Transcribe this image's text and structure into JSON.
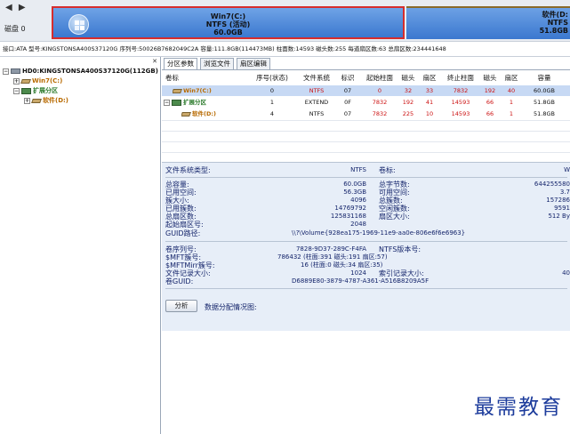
{
  "nav": {
    "arrows": "◀ ▶"
  },
  "disk_bar": {
    "disk_label": "磁盘 0",
    "partitions": [
      {
        "name": "Win7(C:)",
        "fs": "NTFS (活动)",
        "size": "60.0GB"
      },
      {
        "name": "软件(D:",
        "fs": "NTFS",
        "size": "51.8GB"
      }
    ]
  },
  "info_bar": {
    "text": "接口:ATA  型号:KINGSTONSA400S37120G  序列号:50026B7682049C2A  容量:111.8GB(114473MB)  柱面数:14593  磁头数:255  每道扇区数:63  总扇区数:234441648"
  },
  "tree": {
    "close": "✕",
    "items": [
      {
        "box": "−",
        "label": "HD0:KINGSTONSA400S37120G(112GB)"
      },
      {
        "box": "+",
        "label": "Win7(C:)"
      },
      {
        "box": "−",
        "label": "扩展分区"
      },
      {
        "box": "+",
        "label": "软件(D:)"
      }
    ]
  },
  "tabs": [
    "分区参数",
    "浏览文件",
    "扇区编辑"
  ],
  "table": {
    "headers": [
      "卷标",
      "序号(状态)",
      "文件系统",
      "标识",
      "起始柱面",
      "磁头",
      "扇区",
      "终止柱面",
      "磁头",
      "扇区",
      "容量"
    ],
    "rows": [
      [
        "Win7(C:)",
        "0",
        "NTFS",
        "07",
        "0",
        "32",
        "33",
        "7832",
        "192",
        "40",
        "60.0GB"
      ],
      [
        "扩展分区",
        "1",
        "EXTEND",
        "0F",
        "7832",
        "192",
        "41",
        "14593",
        "66",
        "1",
        "51.8GB"
      ],
      [
        "软件(D:)",
        "4",
        "NTFS",
        "07",
        "7832",
        "225",
        "10",
        "14593",
        "66",
        "1",
        "51.8GB"
      ]
    ]
  },
  "details": {
    "fs_type_label": "文件系统类型:",
    "fs_type_value": "NTFS",
    "volume_label": "卷标:",
    "volume_value": "W",
    "left_labels": [
      "总容量:",
      "已用空间:",
      "簇大小:",
      "已用簇数:",
      "总扇区数:",
      "起始扇区号:"
    ],
    "left_values": [
      "60.0GB",
      "56.3GB",
      "4096",
      "14769792",
      "125831168",
      "2048"
    ],
    "right_labels": [
      "总字节数:",
      "可用空间:",
      "总簇数:",
      "空闲簇数:",
      "扇区大小:"
    ],
    "right_values": [
      "644255580",
      "3.7",
      "157286",
      "9591",
      "512 By"
    ],
    "guid_path_label": "GUID路径:",
    "guid_path_value": "\\\\?\\Volume{928ea175-1969-11e9-aa0e-806e6f6e6963}",
    "serial_label": "卷序列号:",
    "serial_value": "7828-9D37-289C-F4FA",
    "ntfs_ver_label": "NTFS版本号:",
    "mft_label": "$MFT簇号:",
    "mft_value": "786432 (柱面:391 磁头:191 扇区:57)",
    "mftmirr_label": "$MFTMirr簇号:",
    "mftmirr_value": "16 (柱面:0 磁头:34 扇区:35)",
    "record_label": "文件记录大小:",
    "record_value": "1024",
    "index_label": "索引记录大小:",
    "index_value": "40",
    "vol_guid_label": "卷GUID:",
    "vol_guid_value": "D6889E80-3879-4787-A361-A516B8209A5F",
    "analyze_button": "分析",
    "analyze_text": "数据分配情况图:"
  },
  "watermark": "最需教育"
}
